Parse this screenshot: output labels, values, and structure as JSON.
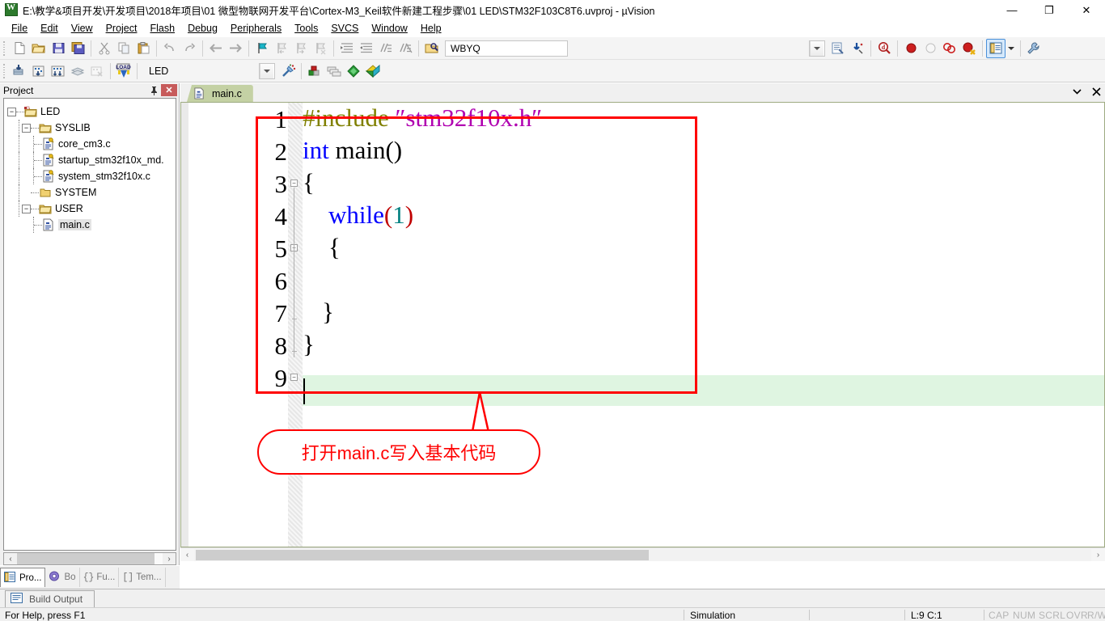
{
  "window": {
    "title": "E:\\教学&项目开发\\开发项目\\2018年项目\\01 微型物联网开发平台\\Cortex-M3_Keil软件新建工程步骤\\01 LED\\STM32F103C8T6.uvproj - µVision",
    "app_icon": "uvision-logo-icon",
    "minimize": "—",
    "maximize": "❐",
    "close": "✕"
  },
  "menu": {
    "items": [
      {
        "label": "File"
      },
      {
        "label": "Edit"
      },
      {
        "label": "View"
      },
      {
        "label": "Project"
      },
      {
        "label": "Flash"
      },
      {
        "label": "Debug"
      },
      {
        "label": "Peripherals"
      },
      {
        "label": "Tools"
      },
      {
        "label": "SVCS"
      },
      {
        "label": "Window"
      },
      {
        "label": "Help"
      }
    ]
  },
  "toolbar_main": {
    "buttons": [
      {
        "name": "new-file-icon",
        "title": "New"
      },
      {
        "name": "open-file-icon",
        "title": "Open"
      },
      {
        "name": "save-icon",
        "title": "Save"
      },
      {
        "name": "save-all-icon",
        "title": "Save All"
      },
      {
        "name": "cut-icon",
        "title": "Cut"
      },
      {
        "name": "copy-icon",
        "title": "Copy"
      },
      {
        "name": "paste-icon",
        "title": "Paste"
      },
      {
        "name": "undo-icon",
        "title": "Undo"
      },
      {
        "name": "redo-icon",
        "title": "Redo"
      },
      {
        "name": "navigate-back-icon",
        "title": "Back"
      },
      {
        "name": "navigate-forward-icon",
        "title": "Forward"
      },
      {
        "name": "bookmark-toggle-icon",
        "title": "Insert/Remove Bookmark"
      },
      {
        "name": "bookmark-prev-icon",
        "title": "Previous Bookmark"
      },
      {
        "name": "bookmark-next-icon",
        "title": "Next Bookmark"
      },
      {
        "name": "bookmark-clear-icon",
        "title": "Clear All Bookmarks"
      },
      {
        "name": "indent-icon",
        "title": "Indent"
      },
      {
        "name": "outdent-icon",
        "title": "Outdent"
      },
      {
        "name": "comment-icon",
        "title": "Comment"
      },
      {
        "name": "uncomment-icon",
        "title": "Uncomment"
      }
    ],
    "find_combo_value": "WBYQ",
    "find_in_files_icon": "find-in-files-icon",
    "bookmark_jump_icon": "goto-definition-icon",
    "search_icon": "find-icon",
    "breakpoint_icons": [
      {
        "name": "insert-breakpoint-icon"
      },
      {
        "name": "kill-breakpoint-icon"
      },
      {
        "name": "disable-breakpoint-icon"
      },
      {
        "name": "kill-all-breakpoints-icon"
      }
    ],
    "project_window_icon": "project-window-icon",
    "project_window_dropdown": "chevron-down-icon",
    "configure-icon": "configure-tools-icon"
  },
  "toolbar_build": {
    "buttons": [
      {
        "name": "translate-icon",
        "title": "Translate"
      },
      {
        "name": "build-icon",
        "title": "Build"
      },
      {
        "name": "rebuild-icon",
        "title": "Rebuild"
      },
      {
        "name": "batch-build-icon",
        "title": "Batch Build"
      },
      {
        "name": "stop-build-icon",
        "title": "Stop Build"
      },
      {
        "name": "download-icon",
        "title": "Download"
      }
    ],
    "target_value": "LED",
    "target_dropdown": "chevron-down-icon",
    "target_options_icon": "target-options-icon",
    "manage_project_items_icon": "manage-project-items-icon",
    "manage_multi_project_icon": "manage-multi-project-icon",
    "manage_run_env_icon": "manage-run-time-environment-icon",
    "pack_installer_icon": "pack-installer-icon"
  },
  "project_panel": {
    "caption": "Project",
    "pin_icon": "pin-icon",
    "close_icon": "close-icon",
    "tree": [
      {
        "label": "LED",
        "depth": 0,
        "icon": "project-target-icon",
        "expander": "−",
        "selected": false
      },
      {
        "label": "SYSLIB",
        "depth": 1,
        "icon": "folder-group-icon",
        "expander": "−",
        "selected": false
      },
      {
        "label": "core_cm3.c",
        "depth": 2,
        "icon": "c-source-key-icon",
        "expander": "",
        "selected": false
      },
      {
        "label": "startup_stm32f10x_md.",
        "depth": 2,
        "icon": "c-source-key-icon",
        "expander": "",
        "selected": false
      },
      {
        "label": "system_stm32f10x.c",
        "depth": 2,
        "icon": "c-source-key-icon",
        "expander": "",
        "selected": false
      },
      {
        "label": "SYSTEM",
        "depth": 1,
        "icon": "folder-empty-icon",
        "expander": "",
        "selected": false
      },
      {
        "label": "USER",
        "depth": 1,
        "icon": "folder-group-icon",
        "expander": "−",
        "selected": false
      },
      {
        "label": "main.c",
        "depth": 2,
        "icon": "c-source-icon",
        "expander": "",
        "selected": true
      }
    ],
    "hscroll_left": "‹",
    "hscroll_right": "›",
    "tabs": [
      {
        "label": "Pro...",
        "icon": "project-icon",
        "active": true
      },
      {
        "label": "Bo",
        "icon": "books-icon",
        "active": false
      },
      {
        "label": "Fu...",
        "icon": "functions-icon",
        "prefix": "{}",
        "active": false
      },
      {
        "label": "Tem...",
        "icon": "templates-icon",
        "prefix": "[]",
        "active": false
      }
    ]
  },
  "editor": {
    "tab": {
      "label": "main.c",
      "icon": "c-source-icon"
    },
    "tabstrip_dropdown": "chevron-down-icon",
    "tabstrip_close": "close-icon",
    "hscroll_left": "‹",
    "hscroll_right": "›",
    "current_line": 9,
    "lines": [
      {
        "n": 1,
        "indent": 0,
        "fold": "",
        "tokens": [
          {
            "t": "#include ",
            "c": "pre"
          },
          {
            "t": "″stm32f10x.h″",
            "c": "str"
          }
        ]
      },
      {
        "n": 2,
        "indent": 0,
        "fold": "",
        "tokens": [
          {
            "t": "int",
            "c": "kw"
          },
          {
            "t": " main",
            "c": "txt"
          },
          {
            "t": "()",
            "c": "pun"
          }
        ]
      },
      {
        "n": 3,
        "indent": 0,
        "fold": "box",
        "tokens": [
          {
            "t": "{",
            "c": "txt"
          }
        ]
      },
      {
        "n": 4,
        "indent": 1,
        "fold": "line",
        "tokens": [
          {
            "t": "while",
            "c": "kw"
          },
          {
            "t": "(",
            "c": "pun"
          },
          {
            "t": "1",
            "c": "num"
          },
          {
            "t": ")",
            "c": "pun"
          }
        ]
      },
      {
        "n": 5,
        "indent": 1,
        "fold": "box2",
        "tokens": [
          {
            "t": "{",
            "c": "txt"
          }
        ]
      },
      {
        "n": 6,
        "indent": 1,
        "fold": "line",
        "tokens": [
          {
            "t": "",
            "c": "txt"
          }
        ]
      },
      {
        "n": 7,
        "indent": 1,
        "fold": "tick",
        "tokens": [
          {
            "t": "}",
            "c": "txt"
          }
        ]
      },
      {
        "n": 8,
        "indent": 0,
        "fold": "tick",
        "tokens": [
          {
            "t": "}",
            "c": "txt"
          }
        ]
      },
      {
        "n": 9,
        "indent": 0,
        "fold": "box3",
        "tokens": [
          {
            "t": "",
            "c": "txt"
          }
        ]
      }
    ]
  },
  "annotation": {
    "callout_text": "打开main.c写入基本代码",
    "color": "#ff0000",
    "highlight_box": "red-rectangle"
  },
  "build_output": {
    "tab_label": "Build Output",
    "icon": "build-output-icon"
  },
  "statusbar": {
    "help_text": "For Help, press F1",
    "debug_mode": "Simulation",
    "cursor_position": "L:9 C:1",
    "indicators": [
      "CAP",
      "NUM",
      "SCRL",
      "OVR",
      "R/W"
    ]
  },
  "colors": {
    "preprocessor": "#808000",
    "string": "#b000b0",
    "keyword": "#0000ff",
    "number": "#008080",
    "punctuation": "#c00000",
    "current_line_bg": "#dff5e1",
    "annotation_red": "#ff0000",
    "tab_active_bg": "#c4d1a4"
  }
}
